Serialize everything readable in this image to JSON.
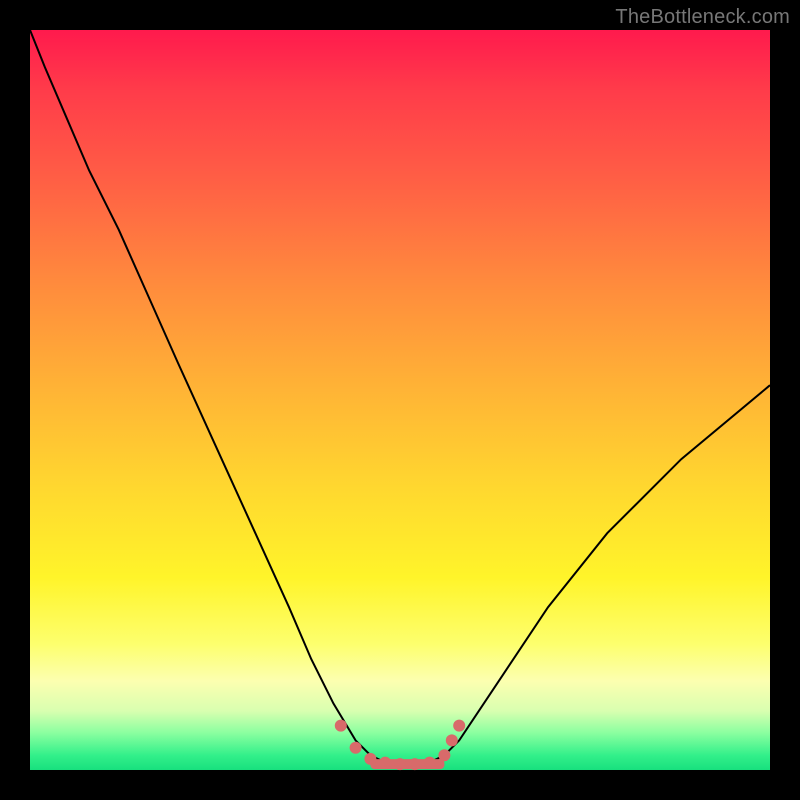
{
  "watermark": "TheBottleneck.com",
  "colors": {
    "frame": "#000000",
    "gradient_top": "#ff1a4d",
    "gradient_mid": "#ffd82f",
    "gradient_bottom": "#18e07e",
    "curve": "#000000",
    "markers": "#d86a6a"
  },
  "chart_data": {
    "type": "line",
    "title": "",
    "xlabel": "",
    "ylabel": "",
    "xlim": [
      0,
      100
    ],
    "ylim": [
      0,
      100
    ],
    "x": [
      0,
      2,
      5,
      8,
      12,
      16,
      20,
      25,
      30,
      35,
      38,
      41,
      44,
      46,
      48,
      50,
      52,
      54,
      56,
      58,
      60,
      64,
      70,
      78,
      88,
      100
    ],
    "y": [
      100,
      95,
      88,
      81,
      73,
      64,
      55,
      44,
      33,
      22,
      15,
      9,
      4,
      2,
      1,
      0.5,
      0.5,
      1,
      2,
      4,
      7,
      13,
      22,
      32,
      42,
      52
    ],
    "markers_x": [
      42,
      44,
      46,
      48,
      50,
      52,
      54,
      56,
      57,
      58
    ],
    "markers_y": [
      6,
      3,
      1.5,
      1,
      0.8,
      0.8,
      1,
      2,
      4,
      6
    ],
    "note": "Values are percentages read off the figure; y=0 is chart bottom (green), y=100 is top (red). No axes/ticks are drawn in the source image."
  }
}
